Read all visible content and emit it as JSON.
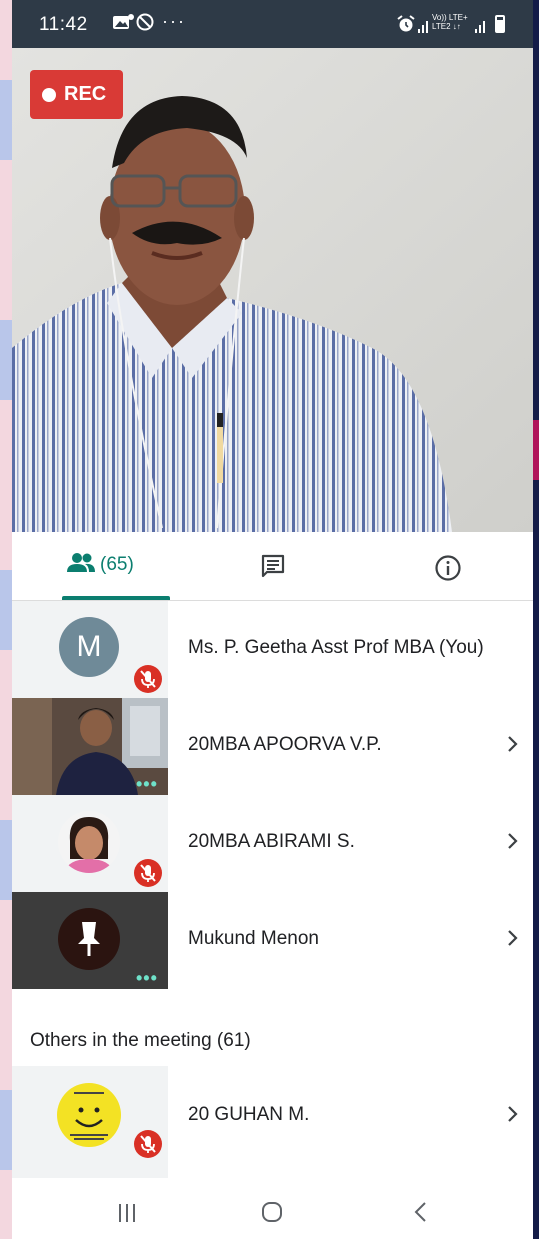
{
  "status_bar": {
    "time": "11:42",
    "notification_icons": [
      "photo-icon",
      "do-not-disturb-icon"
    ],
    "more_indicator": "···",
    "network_label_top": "Vo)) LTE+",
    "network_label_bottom": "LTE2 ↓↑"
  },
  "video": {
    "rec_label": "REC"
  },
  "tabs": {
    "people_count": "(65)",
    "active": "people",
    "items": [
      {
        "id": "people",
        "icon": "people-icon"
      },
      {
        "id": "chat",
        "icon": "chat-icon"
      },
      {
        "id": "info",
        "icon": "info-icon"
      }
    ]
  },
  "participants": [
    {
      "name": "Ms. P. Geetha Asst Prof MBA (You)",
      "avatar_letter": "M",
      "muted": true,
      "has_chevron": false
    },
    {
      "name": "20MBA APOORVA V.P.",
      "muted": false,
      "speaking": true,
      "has_chevron": true
    },
    {
      "name": "20MBA ABIRAMI S.",
      "muted": true,
      "has_chevron": true
    },
    {
      "name": "Mukund Menon",
      "muted": false,
      "speaking": true,
      "has_chevron": true
    }
  ],
  "others": {
    "heading": "Others in the meeting (61)",
    "participants": [
      {
        "name": "20 GUHAN M.",
        "muted": true,
        "has_chevron": true
      }
    ]
  },
  "colors": {
    "accent": "#0b7e6f",
    "rec_red": "#d93a36",
    "mute_red": "#d93025",
    "status_bar": "#2e3a47"
  }
}
